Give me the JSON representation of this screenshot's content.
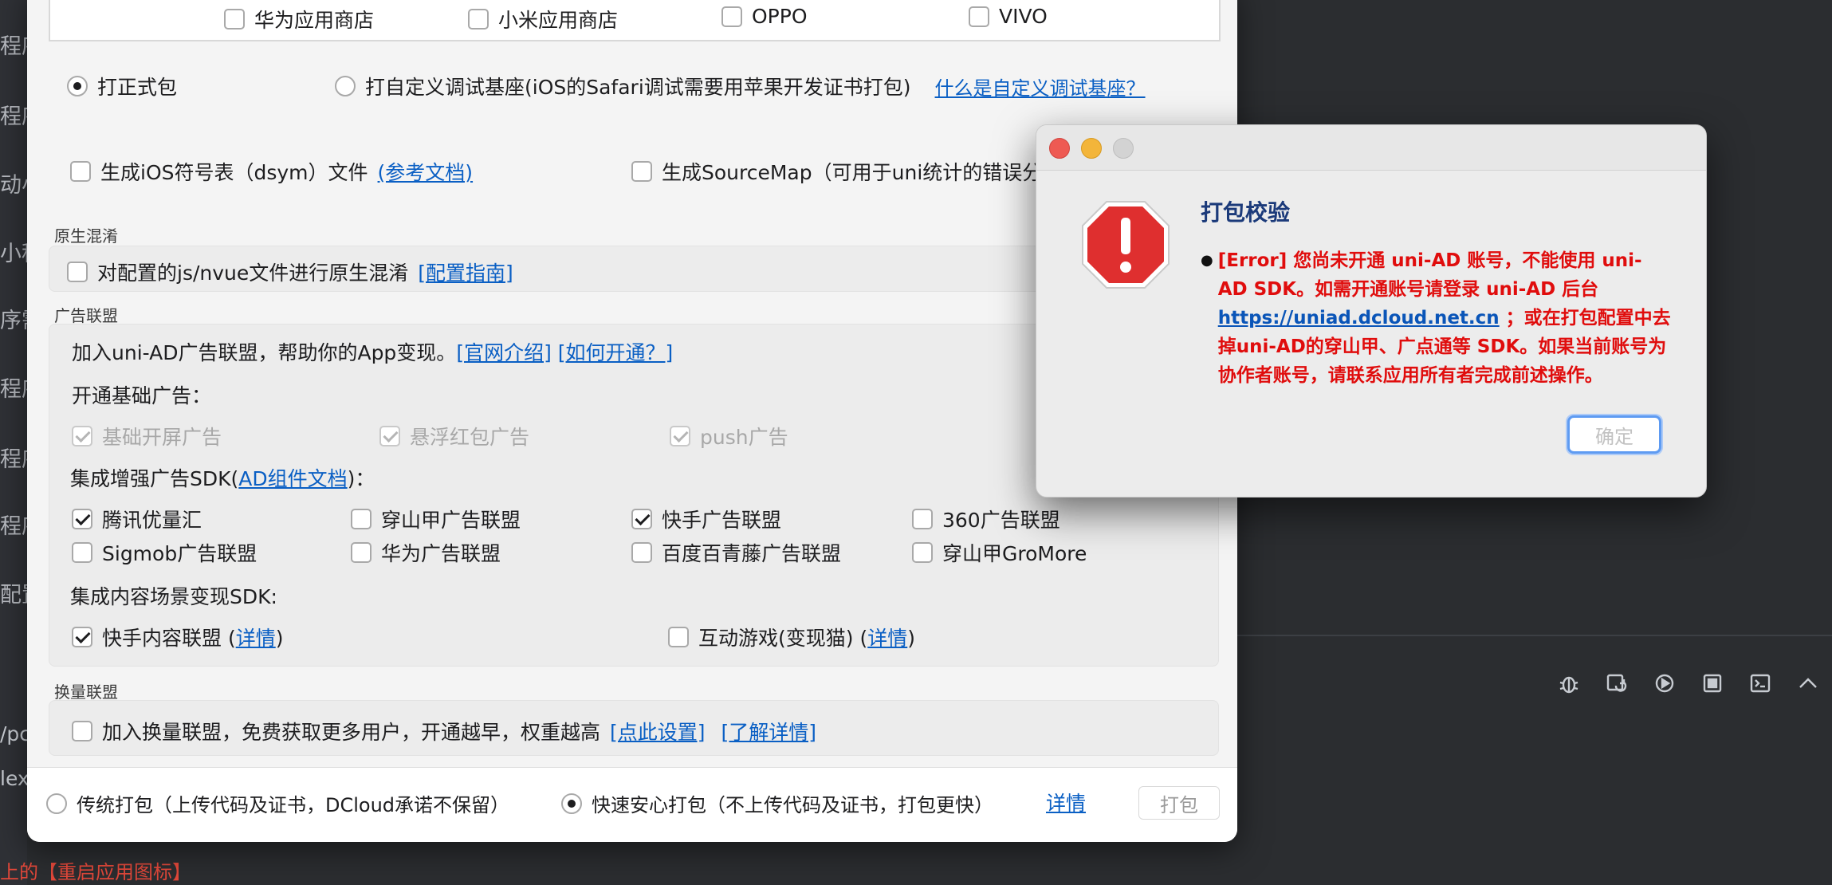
{
  "background": {
    "left_items": [
      "程序",
      "程序",
      "动小",
      "小程",
      "序需",
      "程序",
      "程序",
      "程序",
      "配置"
    ],
    "console_lines": [
      "/pc",
      "lex"
    ],
    "bottom_text": "上的【重启应用图标】"
  },
  "stores": {
    "huawei": "华为应用商店",
    "xiaomi": "小米应用商店",
    "oppo": "OPPO",
    "vivo": "VIVO"
  },
  "package_type": {
    "formal": "打正式包",
    "custom_base": "打自定义调试基座(iOS的Safari调试需要用苹果开发证书打包)",
    "custom_base_link": "什么是自定义调试基座？"
  },
  "options": {
    "dsym": "生成iOS符号表（dsym）文件",
    "dsym_link": "(参考文档)",
    "sourcemap": "生成SourceMap（可用于uni统计的错误分"
  },
  "obfuscation": {
    "title": "原生混淆",
    "label": "对配置的js/nvue文件进行原生混淆",
    "link": "[配置指南]"
  },
  "ad_union": {
    "title": "广告联盟",
    "intro": "加入uni-AD广告联盟，帮助你的App变现。",
    "intro_link1": "[官网介绍]",
    "intro_link2": "[如何开通？]",
    "basic_title": "开通基础广告：",
    "basic": [
      "基础开屏广告",
      "悬浮红包广告",
      "push广告"
    ],
    "enhanced_title_pre": "集成增强广告SDK(",
    "enhanced_title_link": "AD组件文档",
    "enhanced_title_post": ")：",
    "enhanced": [
      "腾讯优量汇",
      "穿山甲广告联盟",
      "快手广告联盟",
      "360广告联盟",
      "Sigmob广告联盟",
      "华为广告联盟",
      "百度百青藤广告联盟",
      "穿山甲GroMore"
    ],
    "content_title": "集成内容场景变现SDK:",
    "content1_label": "快手内容联盟 (",
    "content1_link": "详情",
    "content1_close": ")",
    "content2_label": "互动游戏(变现猫) (",
    "content2_link": "详情",
    "content2_close": ")"
  },
  "exchange": {
    "title": "换量联盟",
    "label": "加入换量联盟，免费获取更多用户，开通越早，权重越高",
    "link1": "[点此设置]",
    "link2": "[了解详情]"
  },
  "footer": {
    "traditional": "传统打包（上传代码及证书，DCloud承诺不保留）",
    "fast": "快速安心打包（不上传代码及证书，打包更快）",
    "details_link": "详情",
    "pack_button": "打包"
  },
  "alert": {
    "title": "打包校验",
    "message_pre": "[Error] 您尚未开通 uni-AD 账号，不能使用 uni-AD SDK。如需开通账号请登录 uni-AD 后台 ",
    "message_link": "https://uniad.dcloud.net.cn",
    "message_post": " ；或在打包配置中去掉uni-AD的穿山甲、广点通等 SDK。如果当前账号为协作者账号，请联系应用所有者完成前述操作。",
    "ok_button": "确定"
  },
  "colors": {
    "accent_link": "#0a5fc4",
    "error_text": "#e00d0d",
    "alert_title": "#1b3a7a",
    "dark_bg": "#2b2d30"
  }
}
